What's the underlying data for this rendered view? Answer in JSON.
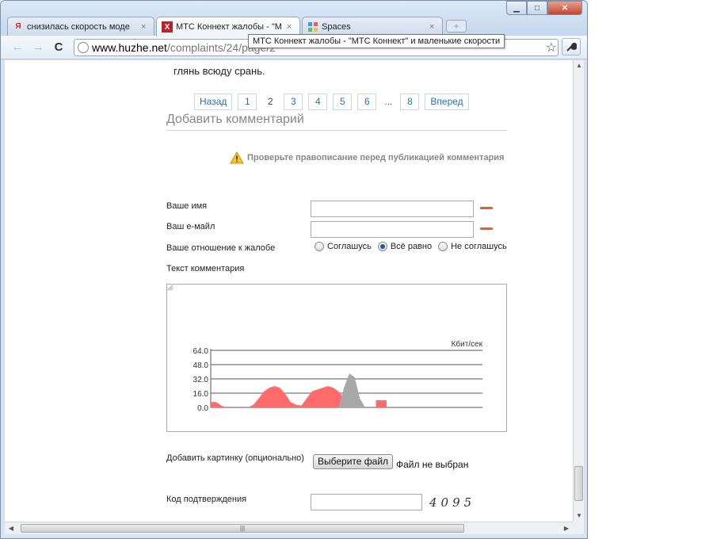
{
  "browser": {
    "tabs": [
      {
        "favicon": "yandex-icon",
        "favicon_glyph": "Я",
        "title": "снизилась скорость моде",
        "active": false
      },
      {
        "favicon": "huzhe-icon",
        "favicon_glyph": "X",
        "title": "МТС Коннект жалобы - \"М",
        "active": true
      },
      {
        "favicon": "spaces-icon",
        "favicon_glyph": "",
        "title": "Spaces",
        "active": false
      }
    ],
    "tab_close_glyph": "×",
    "url": {
      "domain": "www.huzhe.net",
      "path": "/complaints/24/page/2"
    },
    "tooltip": "МТС Коннект жалобы - \"МТС Коннект\" и маленькие скорости",
    "window_buttons": {
      "minimize": "▁",
      "maximize": "□",
      "close": "✕"
    },
    "nav": {
      "back": "←",
      "forward": "→",
      "reload": "C",
      "star": "☆",
      "wrench": "🔧"
    }
  },
  "page": {
    "previous_text": "глянь всюду срань.",
    "pager": {
      "prev": "Назад",
      "pages": [
        "1",
        "2",
        "3",
        "4",
        "5",
        "6",
        "...",
        "8"
      ],
      "current": "2",
      "next": "Вперед"
    },
    "form": {
      "title": "Добавить комментарий",
      "spellcheck_warning": "Проверьте правописание перед публикацией комментария",
      "name_label": "Ваше имя",
      "name_value": "",
      "email_label": "Ваш е-майл",
      "email_value": "",
      "attitude_label": "Ваше отношение к жалобе",
      "attitude_options": [
        {
          "label": "Соглашусь",
          "selected": false
        },
        {
          "label": "Всё равно",
          "selected": true
        },
        {
          "label": "Не соглашусь",
          "selected": false
        }
      ],
      "comment_label": "Текст комментария",
      "image_label": "Добавить картинку (опционально)",
      "file_button": "Выберите файл",
      "file_status": "Файл не выбран",
      "code_label": "Код подтверждения",
      "code_value": "",
      "captcha": "4095"
    }
  },
  "chart_data": {
    "type": "area",
    "ylabel": "Кбит/сек",
    "y_ticks": [
      "64.0",
      "48.0",
      "32.0",
      "16.0",
      "0.0"
    ],
    "ylim": [
      0,
      64
    ],
    "colors": {
      "series_a": "#ff6b6b",
      "series_b": "#a8a8a8"
    },
    "series": [
      {
        "values": [
          6,
          6,
          2,
          0,
          0,
          0,
          0,
          0,
          3,
          10,
          18,
          22,
          24,
          22,
          15,
          6,
          3,
          2,
          10,
          18,
          20,
          22,
          24,
          22,
          18,
          10,
          5,
          2,
          0,
          0,
          0,
          0,
          0,
          0,
          0,
          0,
          0,
          0,
          0,
          0,
          0,
          0,
          0,
          0,
          0,
          0,
          0,
          0,
          0,
          0,
          0,
          0
        ]
      },
      {
        "values": [
          0,
          0,
          0,
          0,
          0,
          0,
          0,
          0,
          0,
          0,
          0,
          0,
          0,
          0,
          0,
          0,
          0,
          0,
          0,
          0,
          0,
          0,
          0,
          0,
          0,
          22,
          38,
          34,
          10,
          0,
          0,
          0,
          0,
          0,
          0,
          0,
          0,
          0,
          0,
          0,
          0,
          0,
          0,
          0,
          0,
          0,
          0,
          0,
          0,
          0,
          0,
          0
        ]
      }
    ],
    "extra_segments": [
      {
        "start_index": 0,
        "end_index": 1,
        "series": 0
      },
      {
        "start_index": 31,
        "end_index": 33,
        "series": 0,
        "values": [
          8,
          8,
          8
        ]
      }
    ]
  }
}
